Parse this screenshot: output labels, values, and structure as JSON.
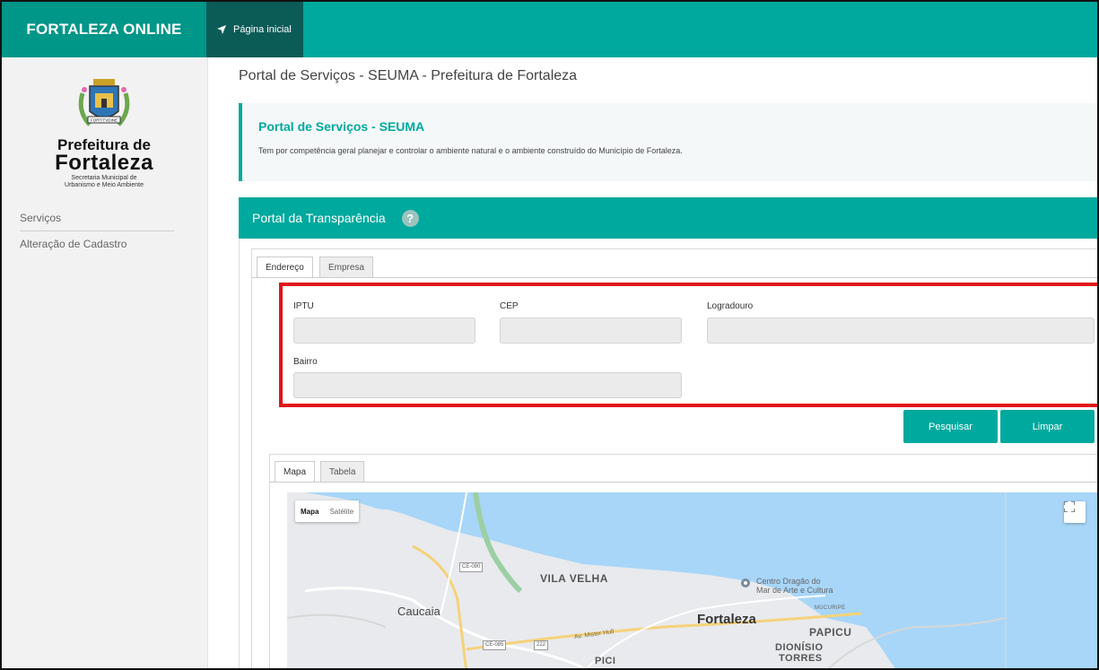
{
  "header": {
    "brand": "FORTALEZA ONLINE",
    "nav_home": "Página inicial"
  },
  "sidebar": {
    "logo": {
      "line1": "Prefeitura de",
      "line2": "Fortaleza",
      "sub1": "Secretaria Municipal de",
      "sub2": "Urbanismo e Meio Ambiente",
      "banner": "FORTITVDINE"
    },
    "items": [
      {
        "label": "Serviços"
      },
      {
        "label": "Alteração de Cadastro"
      }
    ]
  },
  "main": {
    "page_title": "Portal de Serviços - SEUMA - Prefeitura de Fortaleza",
    "info": {
      "title": "Portal de Serviços - SEUMA",
      "description": "Tem por competência geral planejar e controlar o ambiente natural e o ambiente construído do Município de Fortaleza."
    },
    "panel_title": "Portal da Transparência",
    "search_tabs": [
      {
        "label": "Endereço",
        "active": true
      },
      {
        "label": "Empresa",
        "active": false
      }
    ],
    "fields": {
      "iptu": {
        "label": "IPTU",
        "value": ""
      },
      "cep": {
        "label": "CEP",
        "value": ""
      },
      "logradouro": {
        "label": "Logradouro",
        "value": ""
      },
      "bairro": {
        "label": "Bairro",
        "value": ""
      }
    },
    "buttons": {
      "search": "Pesquisar",
      "clear": "Limpar"
    },
    "result_tabs": [
      {
        "label": "Mapa",
        "active": true
      },
      {
        "label": "Tabela",
        "active": false
      }
    ],
    "map": {
      "type_map": "Mapa",
      "type_satellite": "Satélite",
      "labels": {
        "vila_velha": "VILA VELHA",
        "caucaia": "Caucaia",
        "fortaleza": "Fortaleza",
        "papicu": "PAPICU",
        "dionisio1": "DIONÍSIO",
        "dionisio2": "TORRES",
        "pici": "PICI",
        "mucuripe": "MUCURIPE",
        "poi1": "Centro Dragão do",
        "poi2": "Mar de Arte e Cultura",
        "road": "Av. Mister Hull",
        "shield_ce090": "CE-090",
        "shield_ce085": "CE-085",
        "shield_222": "222"
      }
    }
  },
  "colors": {
    "teal": "#00a99d",
    "teal_dark": "#0b5b57",
    "highlight": "#e0141b",
    "sea": "#a8d6f8"
  }
}
